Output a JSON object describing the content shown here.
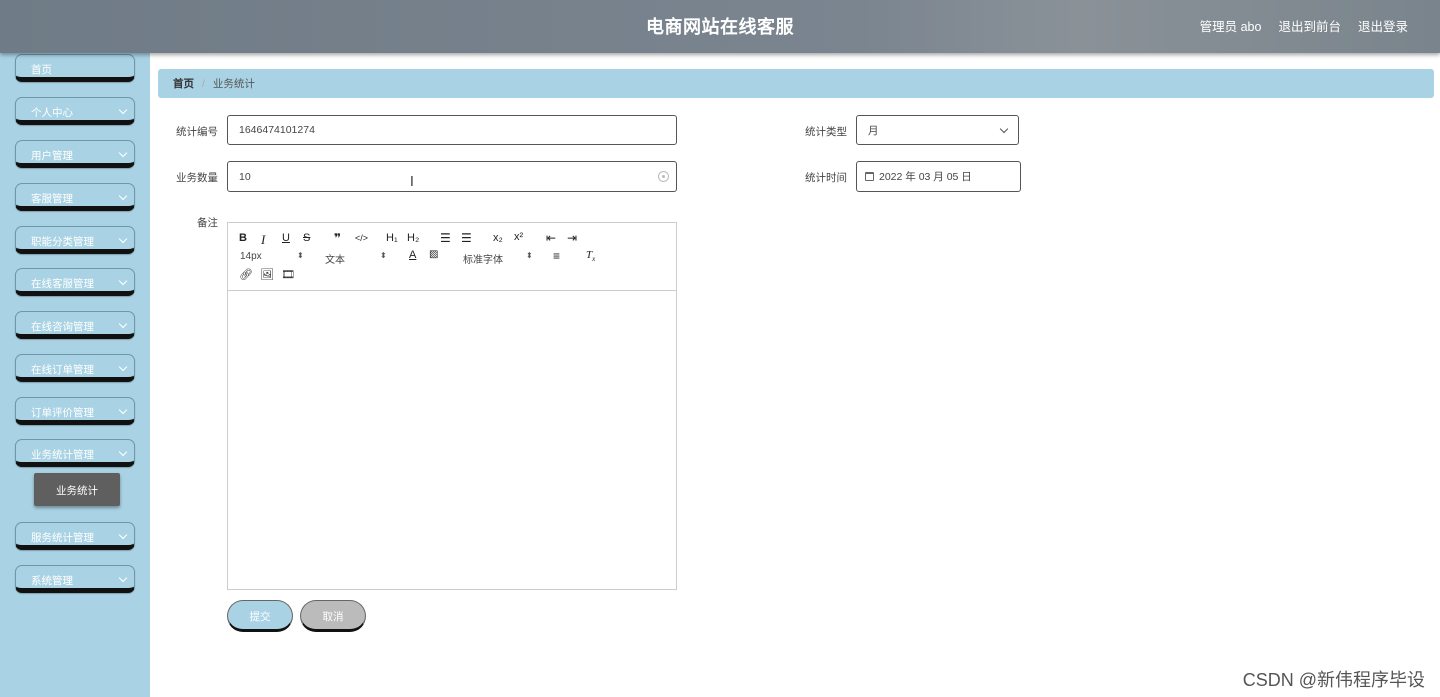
{
  "header": {
    "title": "电商网站在线客服",
    "admin": "管理员 abo",
    "front_link": "退出到前台",
    "logout_link": "退出登录"
  },
  "sidebar": {
    "items": [
      {
        "label": "首页"
      },
      {
        "label": "个人中心"
      },
      {
        "label": "用户管理"
      },
      {
        "label": "客服管理"
      },
      {
        "label": "职能分类管理"
      },
      {
        "label": "在线客服管理"
      },
      {
        "label": "在线咨询管理"
      },
      {
        "label": "在线订单管理"
      },
      {
        "label": "订单评价管理"
      },
      {
        "label": "业务统计管理"
      },
      {
        "label": "服务统计管理"
      },
      {
        "label": "系统管理"
      }
    ],
    "active_sub": "业务统计"
  },
  "breadcrumb": {
    "home": "首页",
    "separator": "/",
    "current": "业务统计"
  },
  "form": {
    "stat_no_label": "统计编号",
    "stat_no_value": "1646474101274",
    "count_label": "业务数量",
    "count_value": "10",
    "type_label": "统计类型",
    "type_value": "月",
    "time_label": "统计时间",
    "time_value": "2022 年 03 月 05 日",
    "remark_label": "备注"
  },
  "editor": {
    "toolbar": {
      "bold": "B",
      "italic": "I",
      "underline": "U",
      "strike": "S",
      "blockquote": "❞",
      "code": "</>",
      "h1": "H₁",
      "h2": "H₂",
      "sub": "x₂",
      "sup": "x²",
      "size": "14px",
      "text": "文本",
      "font": "标准字体"
    }
  },
  "buttons": {
    "submit": "提交",
    "cancel": "取消"
  },
  "watermark": "CSDN @新伟程序毕设"
}
